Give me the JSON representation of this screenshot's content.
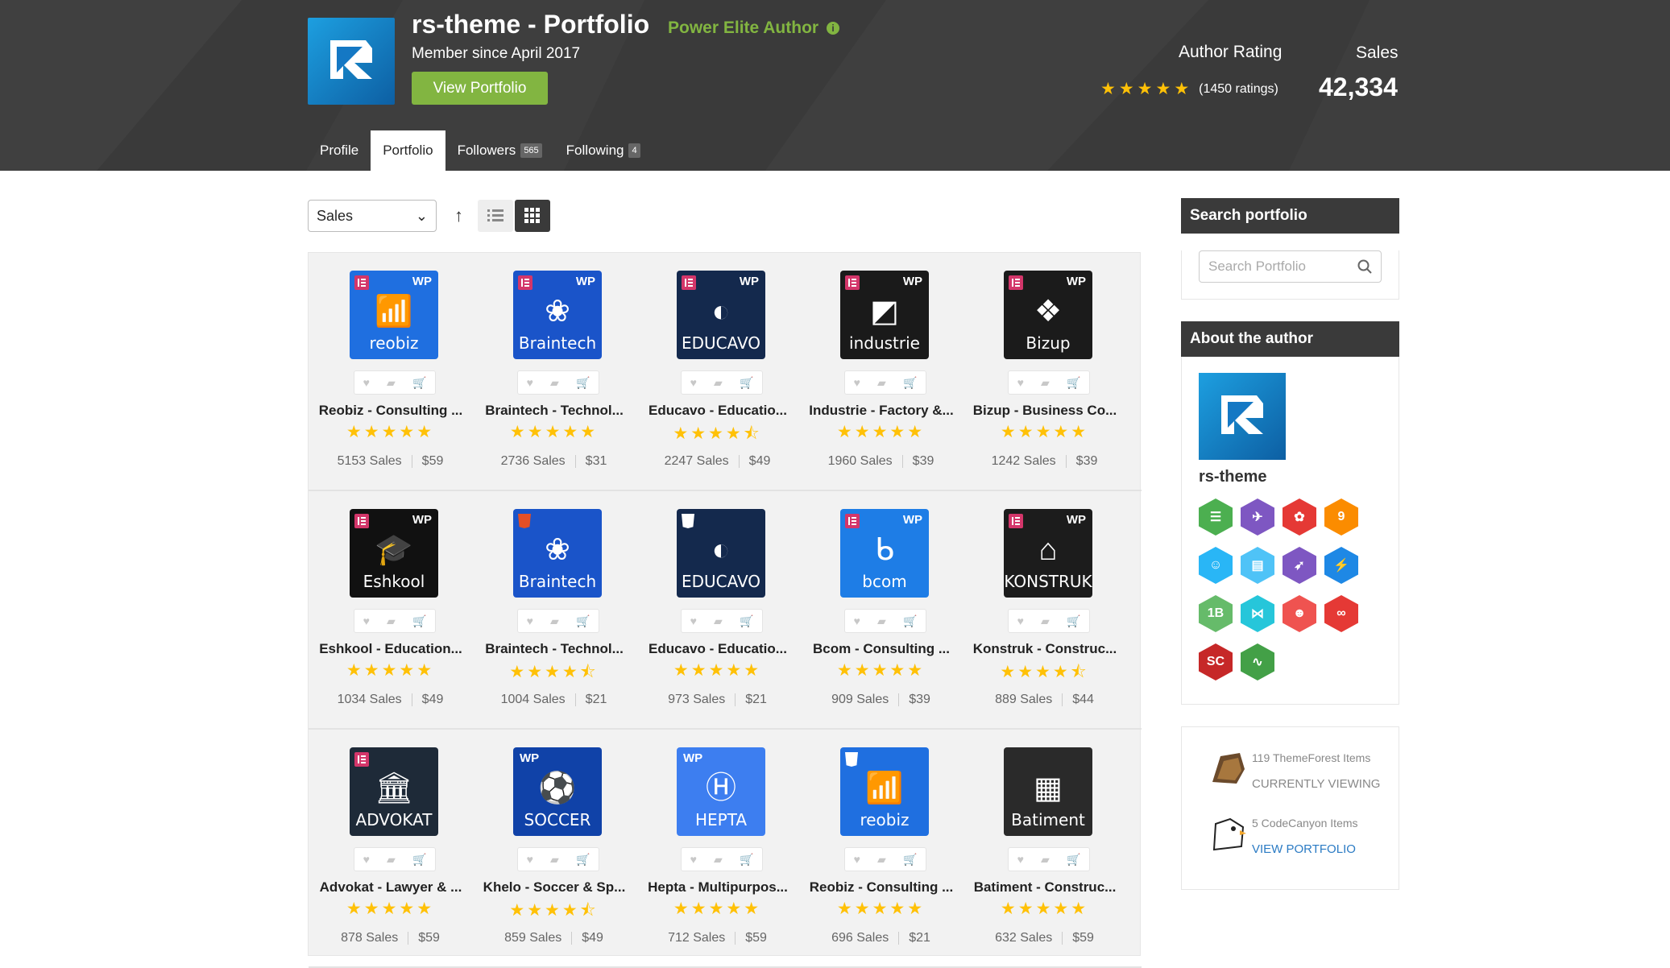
{
  "header": {
    "author_name": "rs-theme - Portfolio",
    "elite_label": "Power Elite Author",
    "member_since": "Member since April 2017",
    "view_portfolio": "View Portfolio",
    "rating_label": "Author Rating",
    "rating_stars": 5,
    "rating_count": "(1450 ratings)",
    "sales_label": "Sales",
    "sales_value": "42,334"
  },
  "tabs": [
    {
      "label": "Profile",
      "count": "",
      "active": false
    },
    {
      "label": "Portfolio",
      "count": "",
      "active": true
    },
    {
      "label": "Followers",
      "count": "565",
      "active": false
    },
    {
      "label": "Following",
      "count": "4",
      "active": false
    }
  ],
  "toolbar": {
    "sort_select": "Sales",
    "sort_icon": "arrow-up-icon",
    "view_list_icon": "list-view-icon",
    "view_grid_icon": "grid-view-icon"
  },
  "items": [
    {
      "title": "Reobiz - Consulting ...",
      "stars": "★★★★★",
      "sales": "5153 Sales",
      "price": "$59",
      "thumb_name": "reobiz",
      "glyph": "📶",
      "bg": "#1f6fe0",
      "badge": "el-wp"
    },
    {
      "title": "Braintech - Technol...",
      "stars": "★★★★★",
      "sales": "2736 Sales",
      "price": "$31",
      "thumb_name": "Braintech",
      "glyph": "❀",
      "bg": "#1a54c9",
      "badge": "el-wp"
    },
    {
      "title": "Educavo - Educatio...",
      "stars": "★★★★⯪",
      "sales": "2247 Sales",
      "price": "$49",
      "thumb_name": "EDUCAVO",
      "glyph": "◐",
      "bg": "#14294d",
      "badge": "el-wp"
    },
    {
      "title": "Industrie - Factory &...",
      "stars": "★★★★★",
      "sales": "1960 Sales",
      "price": "$39",
      "thumb_name": "industrie",
      "glyph": "◩",
      "bg": "#1a1a1a",
      "badge": "el-wp"
    },
    {
      "title": "Bizup - Business Co...",
      "stars": "★★★★★",
      "sales": "1242 Sales",
      "price": "$39",
      "thumb_name": "Bizup",
      "glyph": "❖",
      "bg": "#1b1b1b",
      "badge": "el-wp"
    },
    {
      "title": "Eshkool - Education...",
      "stars": "★★★★★",
      "sales": "1034 Sales",
      "price": "$49",
      "thumb_name": "Eshkool",
      "glyph": "🎓",
      "bg": "#111111",
      "badge": "el-wp"
    },
    {
      "title": "Braintech - Technol...",
      "stars": "★★★★⯪",
      "sales": "1004 Sales",
      "price": "$21",
      "thumb_name": "Braintech",
      "glyph": "❀",
      "bg": "#1a54c9",
      "badge": "h5"
    },
    {
      "title": "Educavo - Educatio...",
      "stars": "★★★★★",
      "sales": "973 Sales",
      "price": "$21",
      "thumb_name": "EDUCAVO",
      "glyph": "◐",
      "bg": "#14294d",
      "badge": "b5"
    },
    {
      "title": "Bcom - Consulting ...",
      "stars": "★★★★★",
      "sales": "909 Sales",
      "price": "$39",
      "thumb_name": "bcom",
      "glyph": "ᑲ",
      "bg": "#1e7de6",
      "badge": "el-wp"
    },
    {
      "title": "Konstruk - Construc...",
      "stars": "★★★★⯪",
      "sales": "889 Sales",
      "price": "$44",
      "thumb_name": "KONSTRUK",
      "glyph": "⌂",
      "bg": "#1c1c1c",
      "badge": "el-wp"
    },
    {
      "title": "Advokat - Lawyer & ...",
      "stars": "★★★★★",
      "sales": "878 Sales",
      "price": "$59",
      "thumb_name": "ADVOKAT",
      "glyph": "🏛",
      "bg": "#1e2a38",
      "badge": "el"
    },
    {
      "title": "Khelo - Soccer & Sp...",
      "stars": "★★★★⯪",
      "sales": "859 Sales",
      "price": "$49",
      "thumb_name": "SOCCER",
      "glyph": "⚽",
      "bg": "#1042a8",
      "badge": "wp-left"
    },
    {
      "title": "Hepta - Multipurpos...",
      "stars": "★★★★★",
      "sales": "712 Sales",
      "price": "$59",
      "thumb_name": "HEPTA",
      "glyph": "Ⓗ",
      "bg": "#3d7ef0",
      "badge": "wp-left"
    },
    {
      "title": "Reobiz - Consulting ...",
      "stars": "★★★★★",
      "sales": "696 Sales",
      "price": "$21",
      "thumb_name": "reobiz",
      "glyph": "📶",
      "bg": "#1f6fe0",
      "badge": "b5"
    },
    {
      "title": "Batiment - Construc...",
      "stars": "★★★★★",
      "sales": "632 Sales",
      "price": "$59",
      "thumb_name": "Batiment",
      "glyph": "▦",
      "bg": "#2a2a2a",
      "badge": "none"
    }
  ],
  "sidebar": {
    "search_title": "Search portfolio",
    "search_placeholder": "Search Portfolio",
    "about_title": "About the author",
    "author_short": "rs-theme",
    "badges": [
      {
        "icon": "stack-icon",
        "color": "#4caf50",
        "text": "☰"
      },
      {
        "icon": "rocket-icon",
        "color": "#7e57c2",
        "text": "✈"
      },
      {
        "icon": "paw-icon",
        "color": "#e53935",
        "text": "✿"
      },
      {
        "icon": "year-9-icon",
        "color": "#fb8c00",
        "text": "9"
      },
      {
        "icon": "user-icon",
        "color": "#29b6f6",
        "text": "☺"
      },
      {
        "icon": "book-icon",
        "color": "#4fc3f7",
        "text": "▤"
      },
      {
        "icon": "rocket-w-icon",
        "color": "#7e57c2",
        "text": "➶"
      },
      {
        "icon": "bolt-icon",
        "color": "#1e88e5",
        "text": "⚡"
      },
      {
        "icon": "sales-1b-icon",
        "color": "#66bb6a",
        "text": "1B"
      },
      {
        "icon": "bow-icon",
        "color": "#26c6da",
        "text": "⋈"
      },
      {
        "icon": "community-icon",
        "color": "#ef5350",
        "text": "☻"
      },
      {
        "icon": "link-icon",
        "color": "#e53935",
        "text": "∞"
      },
      {
        "icon": "sc-icon",
        "color": "#c62828",
        "text": "SC"
      },
      {
        "icon": "pulse-icon",
        "color": "#43a047",
        "text": "∿"
      }
    ],
    "tf_items": "119 ThemeForest Items",
    "tf_status": "CURRENTLY VIEWING",
    "cc_items": "5 CodeCanyon Items",
    "cc_link": "VIEW PORTFOLIO"
  }
}
